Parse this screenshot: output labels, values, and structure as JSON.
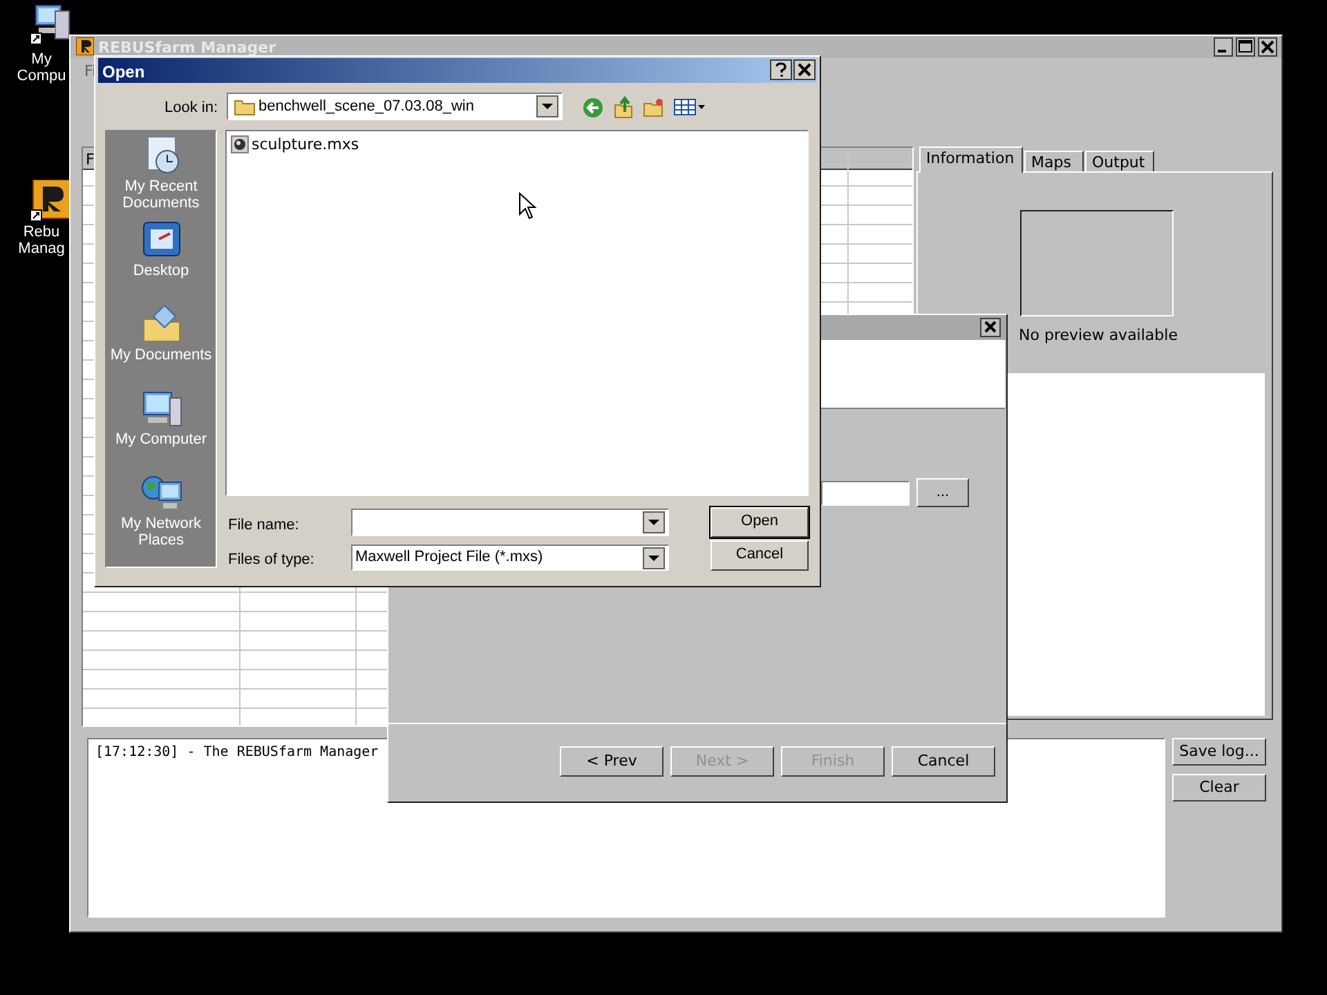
{
  "desktop_icons": [
    {
      "kind": "computer",
      "label": "My Compu"
    },
    {
      "kind": "app",
      "label": "Rebu Manag"
    }
  ],
  "main_window": {
    "title": "REBUSfarm Manager",
    "menu_fragment": "Fi",
    "table": {
      "columns": [
        "F"
      ]
    },
    "tabs": [
      {
        "label": "Information",
        "selected": true
      },
      {
        "label": "Maps",
        "selected": false
      },
      {
        "label": "Output",
        "selected": false
      }
    ],
    "preview_text": "No preview available",
    "log": [
      "[17:12:30] - The REBUSfarm Manager"
    ],
    "log_buttons": [
      "Save log...",
      "Clear"
    ]
  },
  "wizard": {
    "browse_button": "...",
    "buttons": [
      {
        "label": "< Prev",
        "disabled": false
      },
      {
        "label": "Next >",
        "disabled": true
      },
      {
        "label": "Finish",
        "disabled": true
      },
      {
        "label": "Cancel",
        "disabled": false
      }
    ]
  },
  "open_dialog": {
    "title": "Open",
    "look_in_label": "Look in:",
    "folder": "benchwell_scene_07.03.08_win",
    "places": [
      {
        "kind": "recent",
        "label": "My Recent Documents"
      },
      {
        "kind": "desktop",
        "label": "Desktop"
      },
      {
        "kind": "documents",
        "label": "My Documents"
      },
      {
        "kind": "computer",
        "label": "My Computer"
      },
      {
        "kind": "network",
        "label": "My Network Places"
      }
    ],
    "files": [
      {
        "name": "sculpture.mxs"
      }
    ],
    "file_name_label": "File name:",
    "files_of_type_label": "Files of type:",
    "file_type": "Maxwell Project File (*.mxs)",
    "buttons": [
      "Open",
      "Cancel"
    ]
  }
}
